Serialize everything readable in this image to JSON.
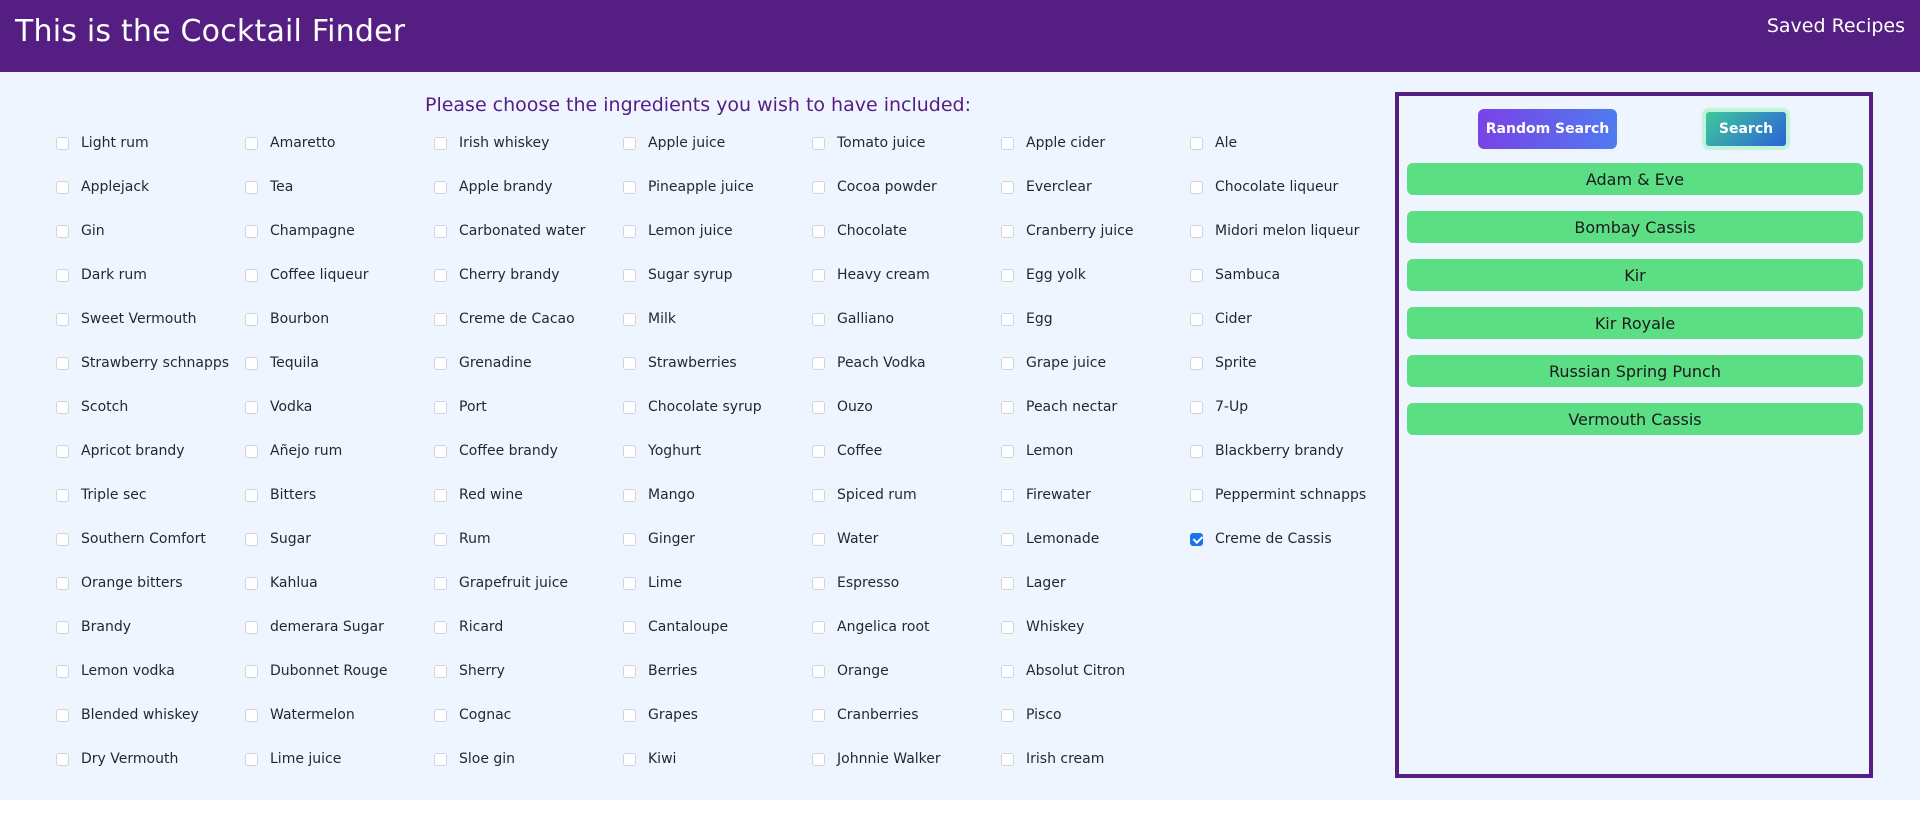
{
  "header": {
    "title": "This is the Cocktail Finder",
    "saved_link": "Saved Recipes"
  },
  "ingredients_section": {
    "heading": "Please choose the ingredients you wish to have included:",
    "items": [
      {
        "label": "Light rum",
        "checked": false
      },
      {
        "label": "Applejack",
        "checked": false
      },
      {
        "label": "Gin",
        "checked": false
      },
      {
        "label": "Dark rum",
        "checked": false
      },
      {
        "label": "Sweet Vermouth",
        "checked": false
      },
      {
        "label": "Strawberry schnapps",
        "checked": false
      },
      {
        "label": "Scotch",
        "checked": false
      },
      {
        "label": "Apricot brandy",
        "checked": false
      },
      {
        "label": "Triple sec",
        "checked": false
      },
      {
        "label": "Southern Comfort",
        "checked": false
      },
      {
        "label": "Orange bitters",
        "checked": false
      },
      {
        "label": "Brandy",
        "checked": false
      },
      {
        "label": "Lemon vodka",
        "checked": false
      },
      {
        "label": "Blended whiskey",
        "checked": false
      },
      {
        "label": "Dry Vermouth",
        "checked": false
      },
      {
        "label": "Amaretto",
        "checked": false
      },
      {
        "label": "Tea",
        "checked": false
      },
      {
        "label": "Champagne",
        "checked": false
      },
      {
        "label": "Coffee liqueur",
        "checked": false
      },
      {
        "label": "Bourbon",
        "checked": false
      },
      {
        "label": "Tequila",
        "checked": false
      },
      {
        "label": "Vodka",
        "checked": false
      },
      {
        "label": "Añejo rum",
        "checked": false
      },
      {
        "label": "Bitters",
        "checked": false
      },
      {
        "label": "Sugar",
        "checked": false
      },
      {
        "label": "Kahlua",
        "checked": false
      },
      {
        "label": "demerara Sugar",
        "checked": false
      },
      {
        "label": "Dubonnet Rouge",
        "checked": false
      },
      {
        "label": "Watermelon",
        "checked": false
      },
      {
        "label": "Lime juice",
        "checked": false
      },
      {
        "label": "Irish whiskey",
        "checked": false
      },
      {
        "label": "Apple brandy",
        "checked": false
      },
      {
        "label": "Carbonated water",
        "checked": false
      },
      {
        "label": "Cherry brandy",
        "checked": false
      },
      {
        "label": "Creme de Cacao",
        "checked": false
      },
      {
        "label": "Grenadine",
        "checked": false
      },
      {
        "label": "Port",
        "checked": false
      },
      {
        "label": "Coffee brandy",
        "checked": false
      },
      {
        "label": "Red wine",
        "checked": false
      },
      {
        "label": "Rum",
        "checked": false
      },
      {
        "label": "Grapefruit juice",
        "checked": false
      },
      {
        "label": "Ricard",
        "checked": false
      },
      {
        "label": "Sherry",
        "checked": false
      },
      {
        "label": "Cognac",
        "checked": false
      },
      {
        "label": "Sloe gin",
        "checked": false
      },
      {
        "label": "Apple juice",
        "checked": false
      },
      {
        "label": "Pineapple juice",
        "checked": false
      },
      {
        "label": "Lemon juice",
        "checked": false
      },
      {
        "label": "Sugar syrup",
        "checked": false
      },
      {
        "label": "Milk",
        "checked": false
      },
      {
        "label": "Strawberries",
        "checked": false
      },
      {
        "label": "Chocolate syrup",
        "checked": false
      },
      {
        "label": "Yoghurt",
        "checked": false
      },
      {
        "label": "Mango",
        "checked": false
      },
      {
        "label": "Ginger",
        "checked": false
      },
      {
        "label": "Lime",
        "checked": false
      },
      {
        "label": "Cantaloupe",
        "checked": false
      },
      {
        "label": "Berries",
        "checked": false
      },
      {
        "label": "Grapes",
        "checked": false
      },
      {
        "label": "Kiwi",
        "checked": false
      },
      {
        "label": "Tomato juice",
        "checked": false
      },
      {
        "label": "Cocoa powder",
        "checked": false
      },
      {
        "label": "Chocolate",
        "checked": false
      },
      {
        "label": "Heavy cream",
        "checked": false
      },
      {
        "label": "Galliano",
        "checked": false
      },
      {
        "label": "Peach Vodka",
        "checked": false
      },
      {
        "label": "Ouzo",
        "checked": false
      },
      {
        "label": "Coffee",
        "checked": false
      },
      {
        "label": "Spiced rum",
        "checked": false
      },
      {
        "label": "Water",
        "checked": false
      },
      {
        "label": "Espresso",
        "checked": false
      },
      {
        "label": "Angelica root",
        "checked": false
      },
      {
        "label": "Orange",
        "checked": false
      },
      {
        "label": "Cranberries",
        "checked": false
      },
      {
        "label": "Johnnie Walker",
        "checked": false
      },
      {
        "label": "Apple cider",
        "checked": false
      },
      {
        "label": "Everclear",
        "checked": false
      },
      {
        "label": "Cranberry juice",
        "checked": false
      },
      {
        "label": "Egg yolk",
        "checked": false
      },
      {
        "label": "Egg",
        "checked": false
      },
      {
        "label": "Grape juice",
        "checked": false
      },
      {
        "label": "Peach nectar",
        "checked": false
      },
      {
        "label": "Lemon",
        "checked": false
      },
      {
        "label": "Firewater",
        "checked": false
      },
      {
        "label": "Lemonade",
        "checked": false
      },
      {
        "label": "Lager",
        "checked": false
      },
      {
        "label": "Whiskey",
        "checked": false
      },
      {
        "label": "Absolut Citron",
        "checked": false
      },
      {
        "label": "Pisco",
        "checked": false
      },
      {
        "label": "Irish cream",
        "checked": false
      },
      {
        "label": "Ale",
        "checked": false
      },
      {
        "label": "Chocolate liqueur",
        "checked": false
      },
      {
        "label": "Midori melon liqueur",
        "checked": false
      },
      {
        "label": "Sambuca",
        "checked": false
      },
      {
        "label": "Cider",
        "checked": false
      },
      {
        "label": "Sprite",
        "checked": false
      },
      {
        "label": "7-Up",
        "checked": false
      },
      {
        "label": "Blackberry brandy",
        "checked": false
      },
      {
        "label": "Peppermint schnapps",
        "checked": false
      },
      {
        "label": "Creme de Cassis",
        "checked": true
      }
    ]
  },
  "results_panel": {
    "random_button": "Random Search",
    "search_button": "Search",
    "results": [
      "Adam & Eve",
      "Bombay Cassis",
      "Kir",
      "Kir Royale",
      "Russian Spring Punch",
      "Vermouth Cassis"
    ]
  },
  "colors": {
    "header_bg": "#541e82",
    "page_bg": "#eef5ff",
    "result_item_bg": "#5cde84",
    "checkbox_checked": "#1a73e8"
  }
}
